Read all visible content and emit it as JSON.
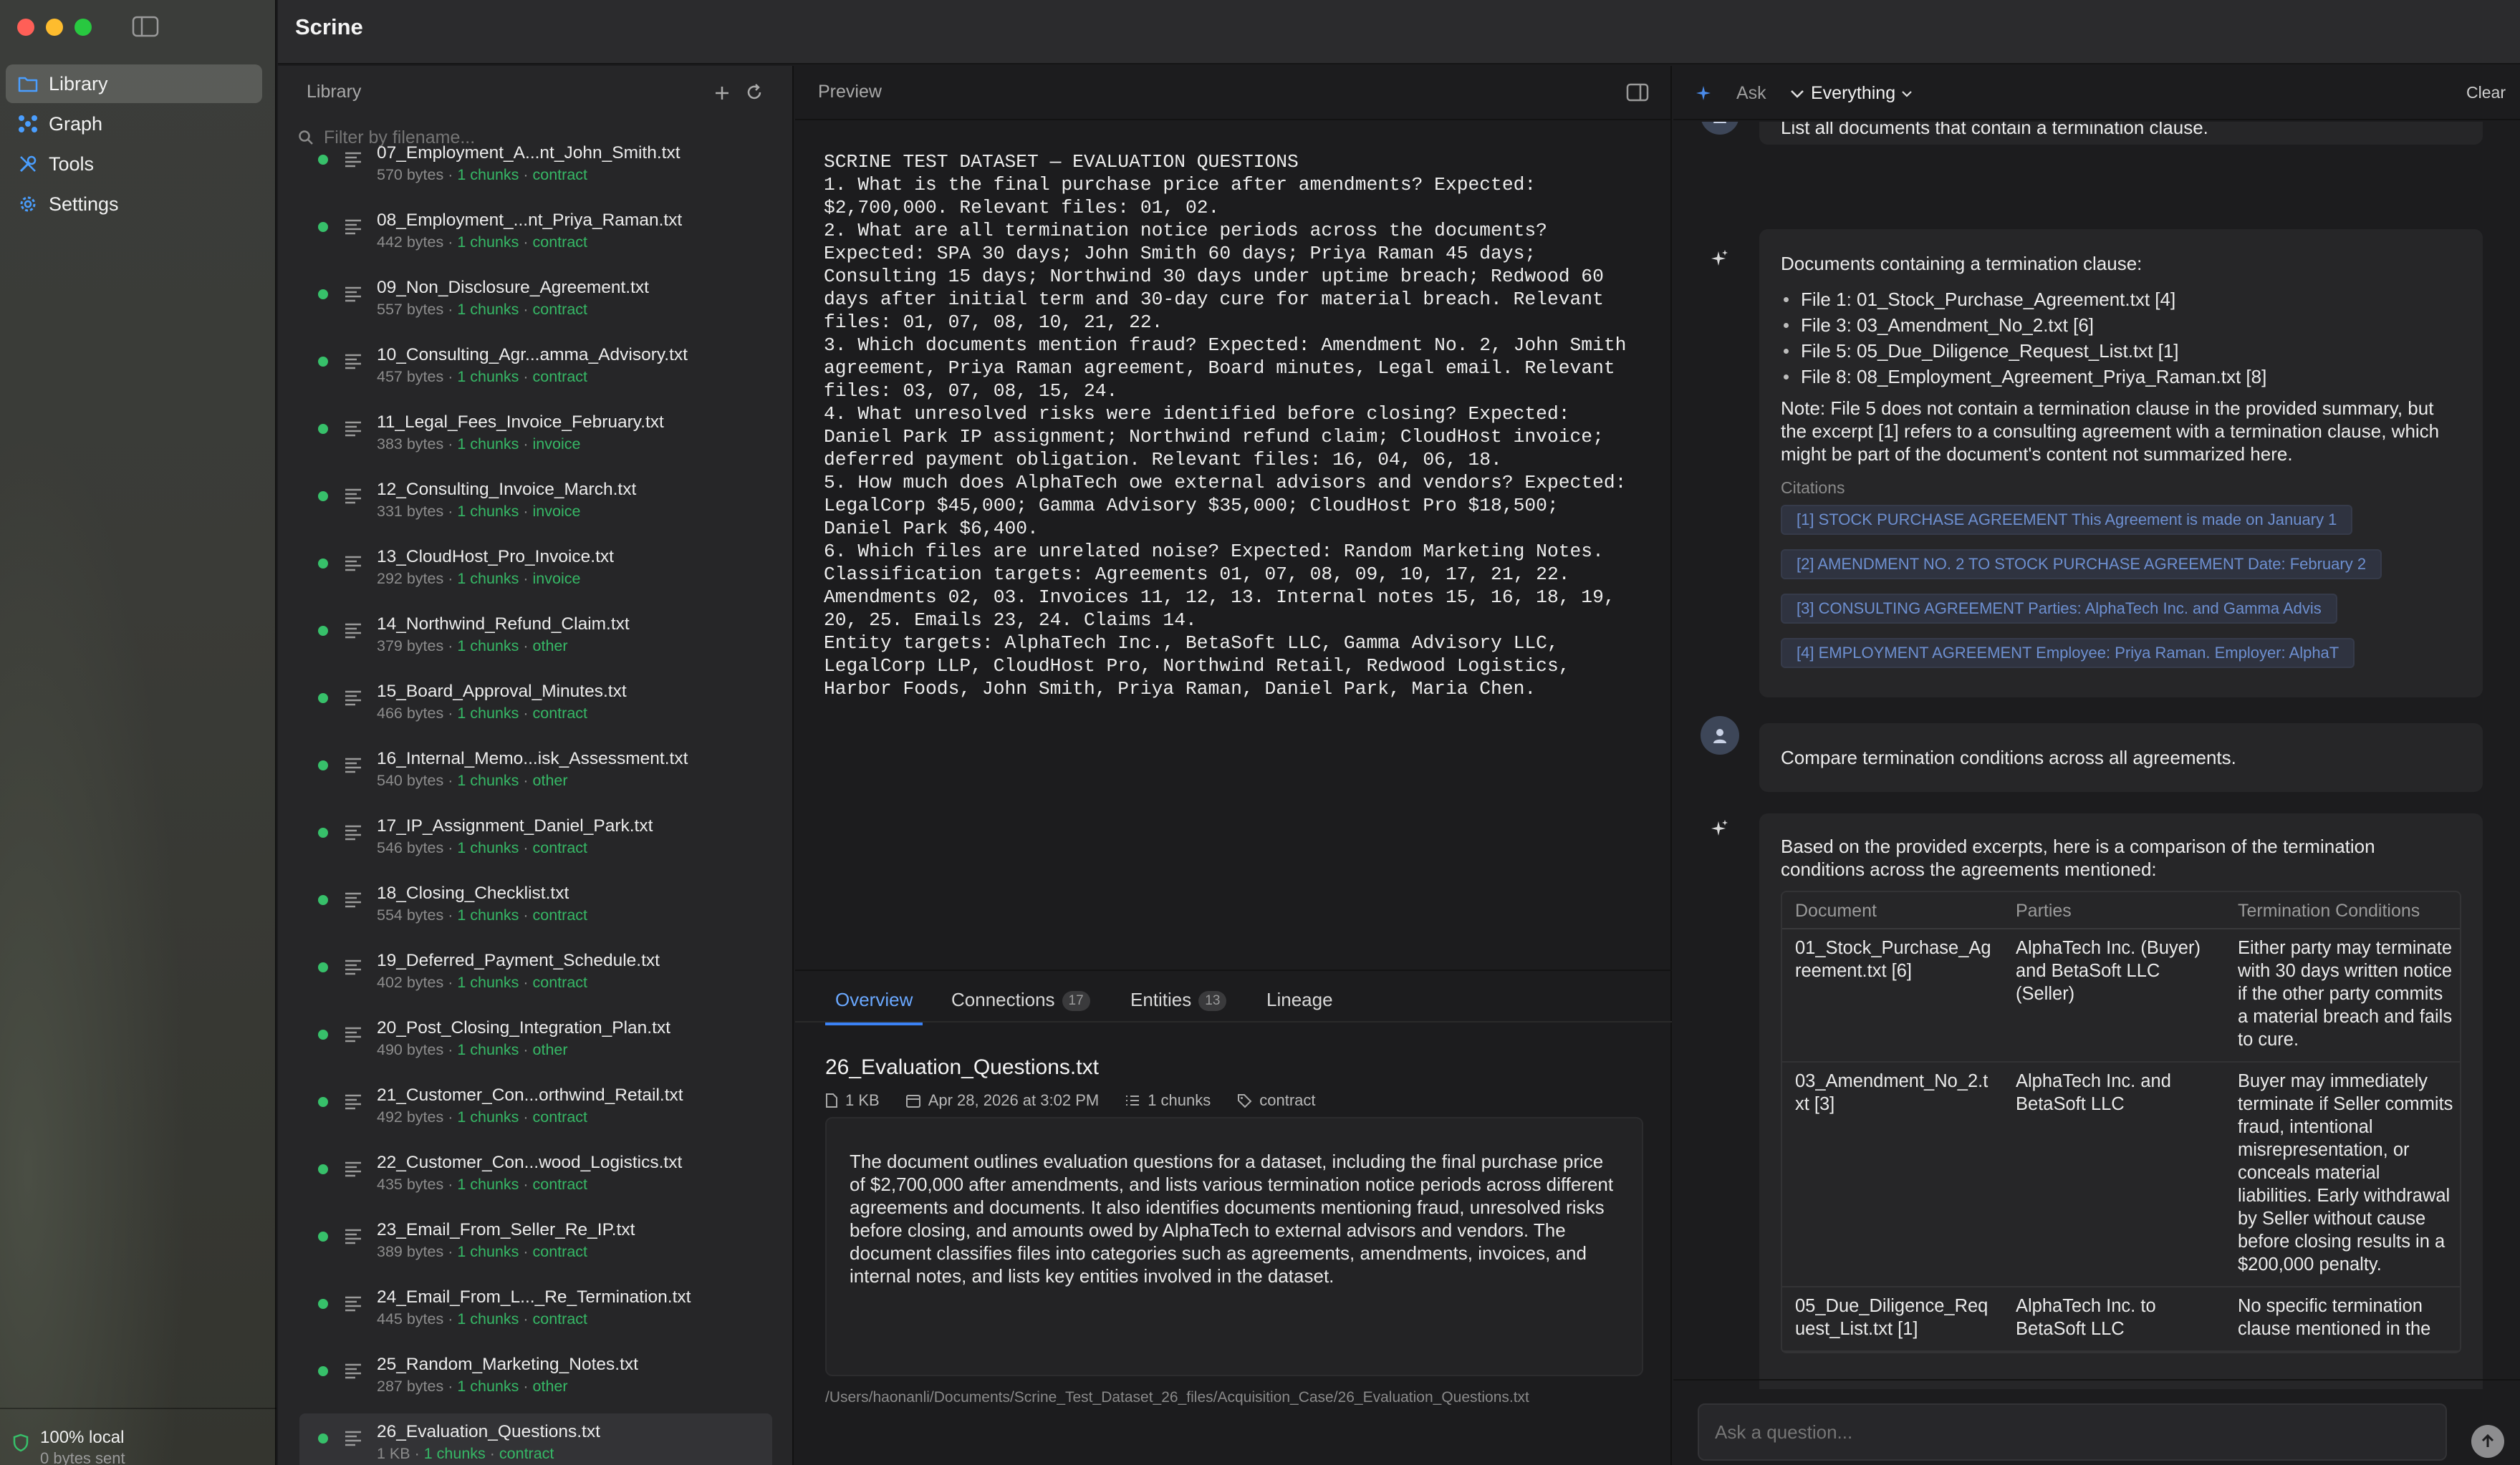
{
  "app": {
    "title": "Scrine"
  },
  "colors": {
    "accent": "#3b82f6",
    "status_green": "#37c06a",
    "close": "#ff5f57",
    "minimize": "#febc2e",
    "zoom": "#28c840"
  },
  "sidebar": {
    "items": [
      {
        "label": "Library",
        "icon": "folder-icon",
        "active": true
      },
      {
        "label": "Graph",
        "icon": "graph-icon",
        "active": false
      },
      {
        "label": "Tools",
        "icon": "tools-icon",
        "active": false
      },
      {
        "label": "Settings",
        "icon": "gear-icon",
        "active": false
      }
    ],
    "footer": {
      "status": "100% local",
      "sub": "0 bytes sent"
    }
  },
  "library": {
    "title": "Library",
    "filter_placeholder": "Filter by filename...",
    "files": [
      {
        "name": "07_Employment_A...nt_John_Smith.txt",
        "size": "570 bytes",
        "chunks": "1 chunks",
        "category": "contract"
      },
      {
        "name": "08_Employment_...nt_Priya_Raman.txt",
        "size": "442 bytes",
        "chunks": "1 chunks",
        "category": "contract"
      },
      {
        "name": "09_Non_Disclosure_Agreement.txt",
        "size": "557 bytes",
        "chunks": "1 chunks",
        "category": "contract"
      },
      {
        "name": "10_Consulting_Agr...amma_Advisory.txt",
        "size": "457 bytes",
        "chunks": "1 chunks",
        "category": "contract"
      },
      {
        "name": "11_Legal_Fees_Invoice_February.txt",
        "size": "383 bytes",
        "chunks": "1 chunks",
        "category": "invoice"
      },
      {
        "name": "12_Consulting_Invoice_March.txt",
        "size": "331 bytes",
        "chunks": "1 chunks",
        "category": "invoice"
      },
      {
        "name": "13_CloudHost_Pro_Invoice.txt",
        "size": "292 bytes",
        "chunks": "1 chunks",
        "category": "invoice"
      },
      {
        "name": "14_Northwind_Refund_Claim.txt",
        "size": "379 bytes",
        "chunks": "1 chunks",
        "category": "other"
      },
      {
        "name": "15_Board_Approval_Minutes.txt",
        "size": "466 bytes",
        "chunks": "1 chunks",
        "category": "contract"
      },
      {
        "name": "16_Internal_Memo...isk_Assessment.txt",
        "size": "540 bytes",
        "chunks": "1 chunks",
        "category": "other"
      },
      {
        "name": "17_IP_Assignment_Daniel_Park.txt",
        "size": "546 bytes",
        "chunks": "1 chunks",
        "category": "contract"
      },
      {
        "name": "18_Closing_Checklist.txt",
        "size": "554 bytes",
        "chunks": "1 chunks",
        "category": "contract"
      },
      {
        "name": "19_Deferred_Payment_Schedule.txt",
        "size": "402 bytes",
        "chunks": "1 chunks",
        "category": "contract"
      },
      {
        "name": "20_Post_Closing_Integration_Plan.txt",
        "size": "490 bytes",
        "chunks": "1 chunks",
        "category": "other"
      },
      {
        "name": "21_Customer_Con...orthwind_Retail.txt",
        "size": "492 bytes",
        "chunks": "1 chunks",
        "category": "contract"
      },
      {
        "name": "22_Customer_Con...wood_Logistics.txt",
        "size": "435 bytes",
        "chunks": "1 chunks",
        "category": "contract"
      },
      {
        "name": "23_Email_From_Seller_Re_IP.txt",
        "size": "389 bytes",
        "chunks": "1 chunks",
        "category": "contract"
      },
      {
        "name": "24_Email_From_L..._Re_Termination.txt",
        "size": "445 bytes",
        "chunks": "1 chunks",
        "category": "contract"
      },
      {
        "name": "25_Random_Marketing_Notes.txt",
        "size": "287 bytes",
        "chunks": "1 chunks",
        "category": "other"
      },
      {
        "name": "26_Evaluation_Questions.txt",
        "size": "1 KB",
        "chunks": "1 chunks",
        "category": "contract",
        "selected": true
      }
    ]
  },
  "preview": {
    "title": "Preview",
    "content": "SCRINE TEST DATASET — EVALUATION QUESTIONS\n1. What is the final purchase price after amendments? Expected:\n$2,700,000. Relevant files: 01, 02.\n2. What are all termination notice periods across the documents?\nExpected: SPA 30 days; John Smith 60 days; Priya Raman 45 days;\nConsulting 15 days; Northwind 30 days under uptime breach; Redwood 60\ndays after initial term and 30-day cure for material breach. Relevant\nfiles: 01, 07, 08, 10, 21, 22.\n3. Which documents mention fraud? Expected: Amendment No. 2, John Smith\nagreement, Priya Raman agreement, Board minutes, Legal email. Relevant\nfiles: 03, 07, 08, 15, 24.\n4. What unresolved risks were identified before closing? Expected:\nDaniel Park IP assignment; Northwind refund claim; CloudHost invoice;\ndeferred payment obligation. Relevant files: 16, 04, 06, 18.\n5. How much does AlphaTech owe external advisors and vendors? Expected:\nLegalCorp $45,000; Gamma Advisory $35,000; CloudHost Pro $18,500;\nDaniel Park $6,400.\n6. Which files are unrelated noise? Expected: Random Marketing Notes.\nClassification targets: Agreements 01, 07, 08, 09, 10, 17, 21, 22.\nAmendments 02, 03. Invoices 11, 12, 13. Internal notes 15, 16, 18, 19,\n20, 25. Emails 23, 24. Claims 14.\nEntity targets: AlphaTech Inc., BetaSoft LLC, Gamma Advisory LLC,\nLegalCorp LLP, CloudHost Pro, Northwind Retail, Redwood Logistics,\nHarbor Foods, John Smith, Priya Raman, Daniel Park, Maria Chen.",
    "tabs": [
      {
        "label": "Overview",
        "count": null,
        "active": true
      },
      {
        "label": "Connections",
        "count": "17",
        "active": false
      },
      {
        "label": "Entities",
        "count": "13",
        "active": false
      },
      {
        "label": "Lineage",
        "count": null,
        "active": false
      }
    ],
    "doc": {
      "name": "26_Evaluation_Questions.txt",
      "size": "1 KB",
      "date": "Apr 28, 2026 at 3:02 PM",
      "chunks": "1 chunks",
      "tag": "contract",
      "summary": "The document outlines evaluation questions for a dataset, including the final purchase price of $2,700,000 after amendments, and lists various termination notice periods across different agreements and documents. It also identifies documents mentioning fraud, unresolved risks before closing, and amounts owed by AlphaTech to external advisors and vendors. The document classifies files into categories such as agreements, amendments, invoices, and internal notes, and lists key entities involved in the dataset.",
      "path": "/Users/haonanli/Documents/Scrine_Test_Dataset_26_files/Acquisition_Case/26_Evaluation_Questions.txt"
    }
  },
  "chat": {
    "ask_label": "Ask",
    "scope": "Everything",
    "clear_label": "Clear",
    "prev_question": "List all documents that contain a termination clause.",
    "answer1": {
      "intro": "Documents containing a termination clause:",
      "bullets": [
        "File 1: 01_Stock_Purchase_Agreement.txt [4]",
        "File 3: 03_Amendment_No_2.txt [6]",
        "File 5: 05_Due_Diligence_Request_List.txt [1]",
        "File 8: 08_Employment_Agreement_Priya_Raman.txt [8]"
      ],
      "note": "Note: File 5 does not contain a termination clause in the provided summary, but the excerpt [1] refers to a consulting agreement with a termination clause, which might be part of the document's content not summarized here.",
      "citations_label": "Citations",
      "citations": [
        "[1] STOCK PURCHASE AGREEMENT This Agreement is made on January 1",
        "[2] AMENDMENT NO. 2 TO STOCK PURCHASE AGREEMENT Date: February 2",
        "[3] CONSULTING AGREEMENT Parties: AlphaTech Inc. and Gamma Advis",
        "[4] EMPLOYMENT AGREEMENT Employee: Priya Raman. Employer: AlphaT"
      ]
    },
    "user_question": "Compare termination conditions across all agreements.",
    "answer2": {
      "intro": "Based on the provided excerpts, here is a comparison of the termination conditions across the agreements mentioned:",
      "table": {
        "headers": [
          "Document",
          "Parties",
          "Termination Conditions"
        ],
        "rows": [
          [
            "01_Stock_Purchase_Agreement.txt [6]",
            "AlphaTech Inc. (Buyer) and BetaSoft LLC (Seller)",
            "Either party may terminate with 30 days written notice if the other party commits a material breach and fails to cure."
          ],
          [
            "03_Amendment_No_2.txt [3]",
            "AlphaTech Inc. and BetaSoft LLC",
            "Buyer may immediately terminate if Seller commits fraud, intentional misrepresentation, or conceals material liabilities. Early withdrawal by Seller without cause before closing results in a $200,000 penalty."
          ],
          [
            "05_Due_Diligence_Request_List.txt [1]",
            "AlphaTech Inc. to BetaSoft LLC",
            "No specific termination clause mentioned in the"
          ]
        ]
      }
    },
    "input_placeholder": "Ask a question..."
  }
}
